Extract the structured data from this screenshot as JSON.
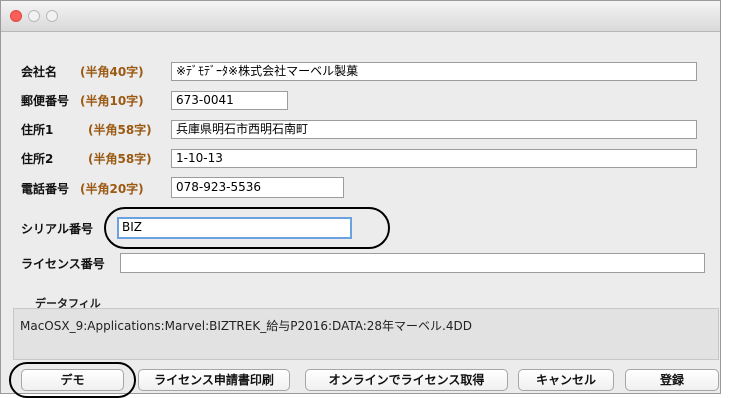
{
  "form": {
    "company": {
      "label": "会社名",
      "hint": "(半角40字)",
      "value": "※ﾃﾞﾓﾃﾞｰﾀ※株式会社マーベル製菓"
    },
    "postal": {
      "label": "郵便番号",
      "hint": "(半角10字)",
      "value": "673-0041"
    },
    "address1": {
      "label": "住所1",
      "hint": "(半角58字)",
      "value": "兵庫県明石市西明石南町"
    },
    "address2": {
      "label": "住所2",
      "hint": "(半角58字)",
      "value": "1-10-13"
    },
    "phone": {
      "label": "電話番号",
      "hint": "(半角20字)",
      "value": "078-923-5536"
    },
    "serial": {
      "label": "シリアル番号",
      "value": "BIZ"
    },
    "license": {
      "label": "ライセンス番号",
      "value": ""
    }
  },
  "datafile": {
    "title": "データフィル",
    "path": "MacOSX_9:Applications:Marvel:BIZTREK_給与P2016:DATA:28年マーベル.4DD"
  },
  "buttons": {
    "demo": "デモ",
    "print": "ライセンス申請書印刷",
    "online": "オンラインでライセンス取得",
    "cancel": "キャンセル",
    "register": "登録"
  }
}
